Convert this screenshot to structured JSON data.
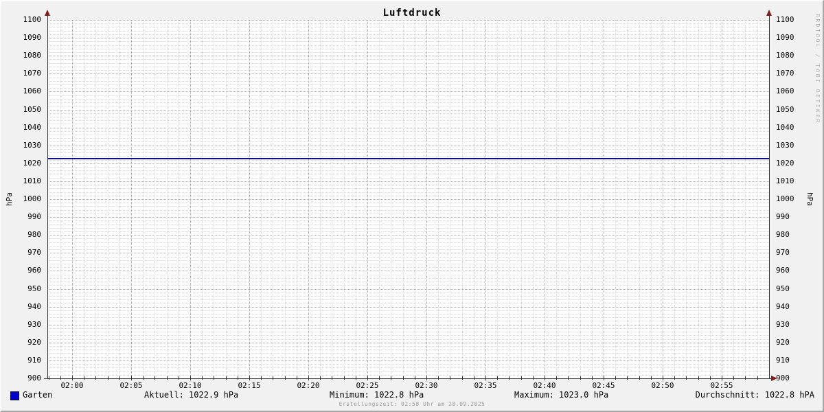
{
  "title": "Luftdruck",
  "left_axis_label": "hPa",
  "right_axis_label": "hPa",
  "watermark": "RRDTOOL / TOBI OETIKER",
  "footer": "Erstellungszeit: 02:58 Uhr am 28.09.2025",
  "legend": {
    "series_name": "Garten",
    "series_swatch_color": "#0000cc",
    "stats": [
      {
        "text": "Aktuell: 1022.9 hPa"
      },
      {
        "text": "Minimum: 1022.8 hPa"
      },
      {
        "text": "Maximum: 1023.0 hPa"
      },
      {
        "text": "Durchschnitt: 1022.8 hPA"
      }
    ]
  },
  "colors": {
    "grid_major": "#e09090",
    "grid_minor": "#d6d6d6",
    "line": "#0000c0",
    "axis_arrow": "#7f1d1d",
    "plot_background": "#ffffff",
    "canvas_background": "#f1f1f1"
  },
  "chart_data": {
    "type": "line",
    "title": "Luftdruck",
    "ylabel": "hPa",
    "ylabel_right": "hPa",
    "ylim": [
      900,
      1100
    ],
    "y_major_step": 10,
    "y_minor_step": 2,
    "x_tick_labels": [
      "02:00",
      "02:05",
      "02:10",
      "02:15",
      "02:20",
      "02:25",
      "02:30",
      "02:35",
      "02:40",
      "02:45",
      "02:50",
      "02:55"
    ],
    "x_minor_step_minutes": 1,
    "x_range_minutes": {
      "start_minute": 118,
      "end_minute": 179
    },
    "grid": {
      "style": "dotted",
      "legend_position": "bottom"
    },
    "series": [
      {
        "name": "Garten",
        "color": "#0000c0",
        "shape": "nearly constant horizontal line across the whole time range",
        "current": 1022.9,
        "minimum": 1022.8,
        "maximum": 1023.0,
        "average": 1022.8,
        "x": [
          "02:00",
          "02:05",
          "02:10",
          "02:15",
          "02:20",
          "02:25",
          "02:30",
          "02:35",
          "02:40",
          "02:45",
          "02:50",
          "02:55"
        ],
        "values": [
          1022.9,
          1022.9,
          1022.9,
          1022.8,
          1022.8,
          1022.9,
          1023.0,
          1022.9,
          1022.8,
          1022.8,
          1022.9,
          1022.9
        ]
      }
    ]
  }
}
